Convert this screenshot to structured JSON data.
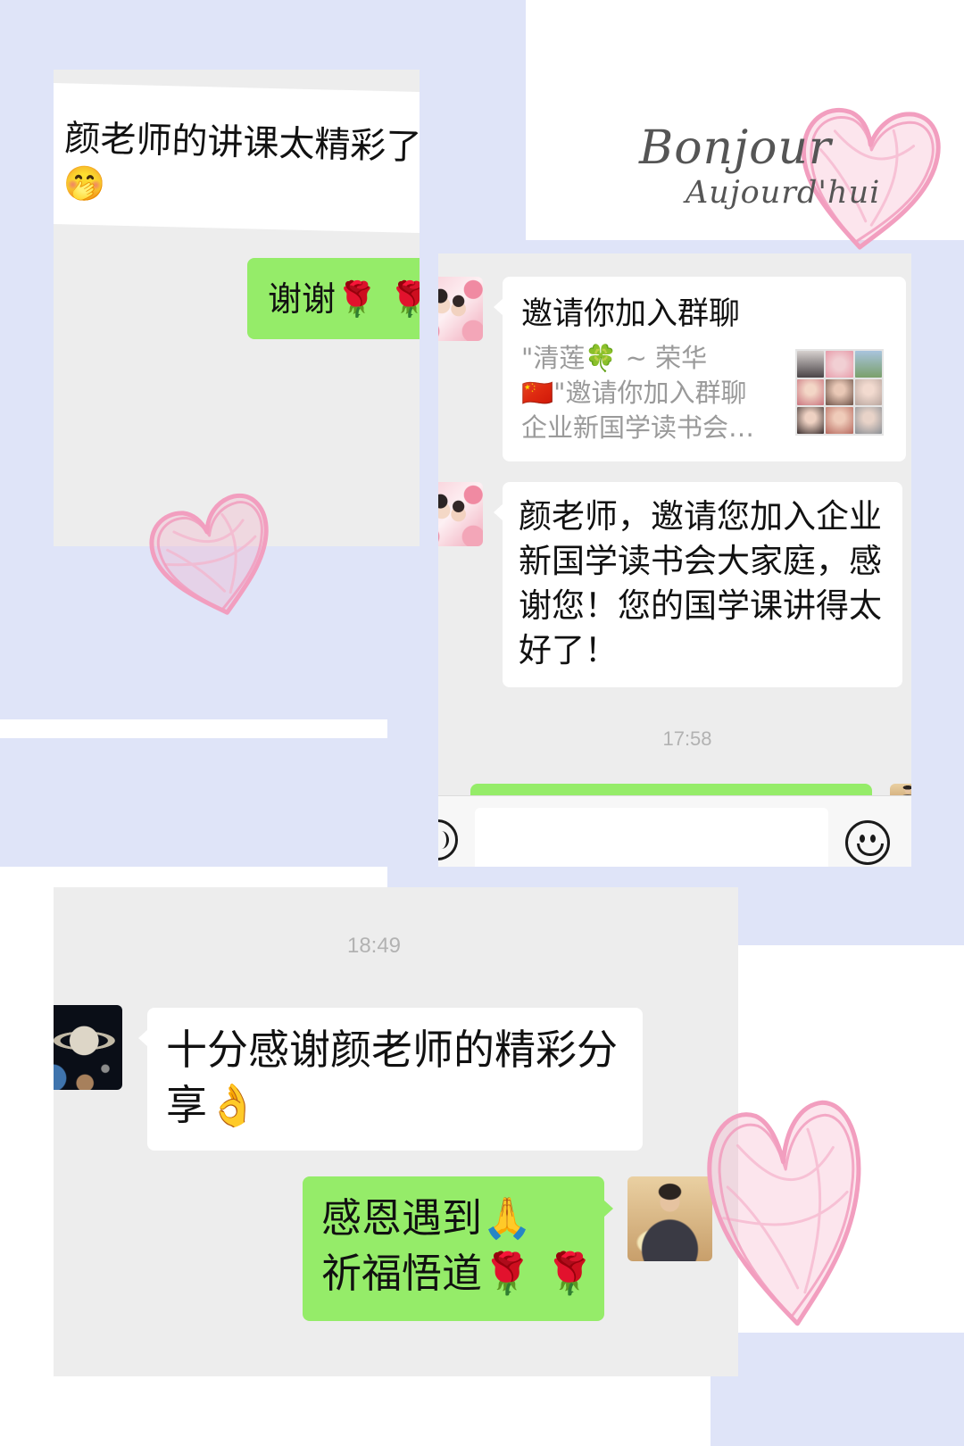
{
  "colors": {
    "lavender_panel": "#dfe4f8",
    "chat_background": "#ededed",
    "incoming_bubble": "#ffffff",
    "outgoing_bubble": "#95ec69",
    "heart_pink": "#f29ebf",
    "timestamp_gray": "#b2b2b2"
  },
  "decor": {
    "title_line1": "Bonjour",
    "title_line2": "Aujourd'hui"
  },
  "chat1": {
    "incoming_message": {
      "text": "颜老师的讲课太精彩了",
      "emoji": "🤭"
    },
    "outgoing_message": {
      "text": "谢谢🌹 🌹"
    }
  },
  "chat2": {
    "sender_avatar_icon": "floral-portrait-avatar",
    "group_invite_card": {
      "title": "邀请你加入群聊",
      "description_lines": [
        "\"清莲🍀 ~ 荣华",
        "🇨🇳\"邀请你加入群聊",
        "企业新国学读书会…"
      ],
      "thumbnail_icon": "group-avatar-grid"
    },
    "incoming_message": {
      "lines": [
        "颜老师，邀请您加入企业",
        "新国学读书会大家庭，感",
        "谢您！您的国学课讲得太",
        "好了！"
      ]
    },
    "timestamp": "17:58",
    "composer": {
      "value": "",
      "left_icon": "voice-icon",
      "right_icon": "emoji-icon"
    }
  },
  "chat3": {
    "timestamp": "18:49",
    "sender_avatar_icon": "planet-avatar",
    "self_avatar_icon": "man-with-fan-avatar",
    "incoming_message": {
      "lines": [
        "十分感谢颜老师的精彩分",
        "享👌"
      ]
    },
    "outgoing_message": {
      "lines": [
        "感恩遇到🙏",
        "祈福悟道🌹 🌹"
      ]
    }
  }
}
